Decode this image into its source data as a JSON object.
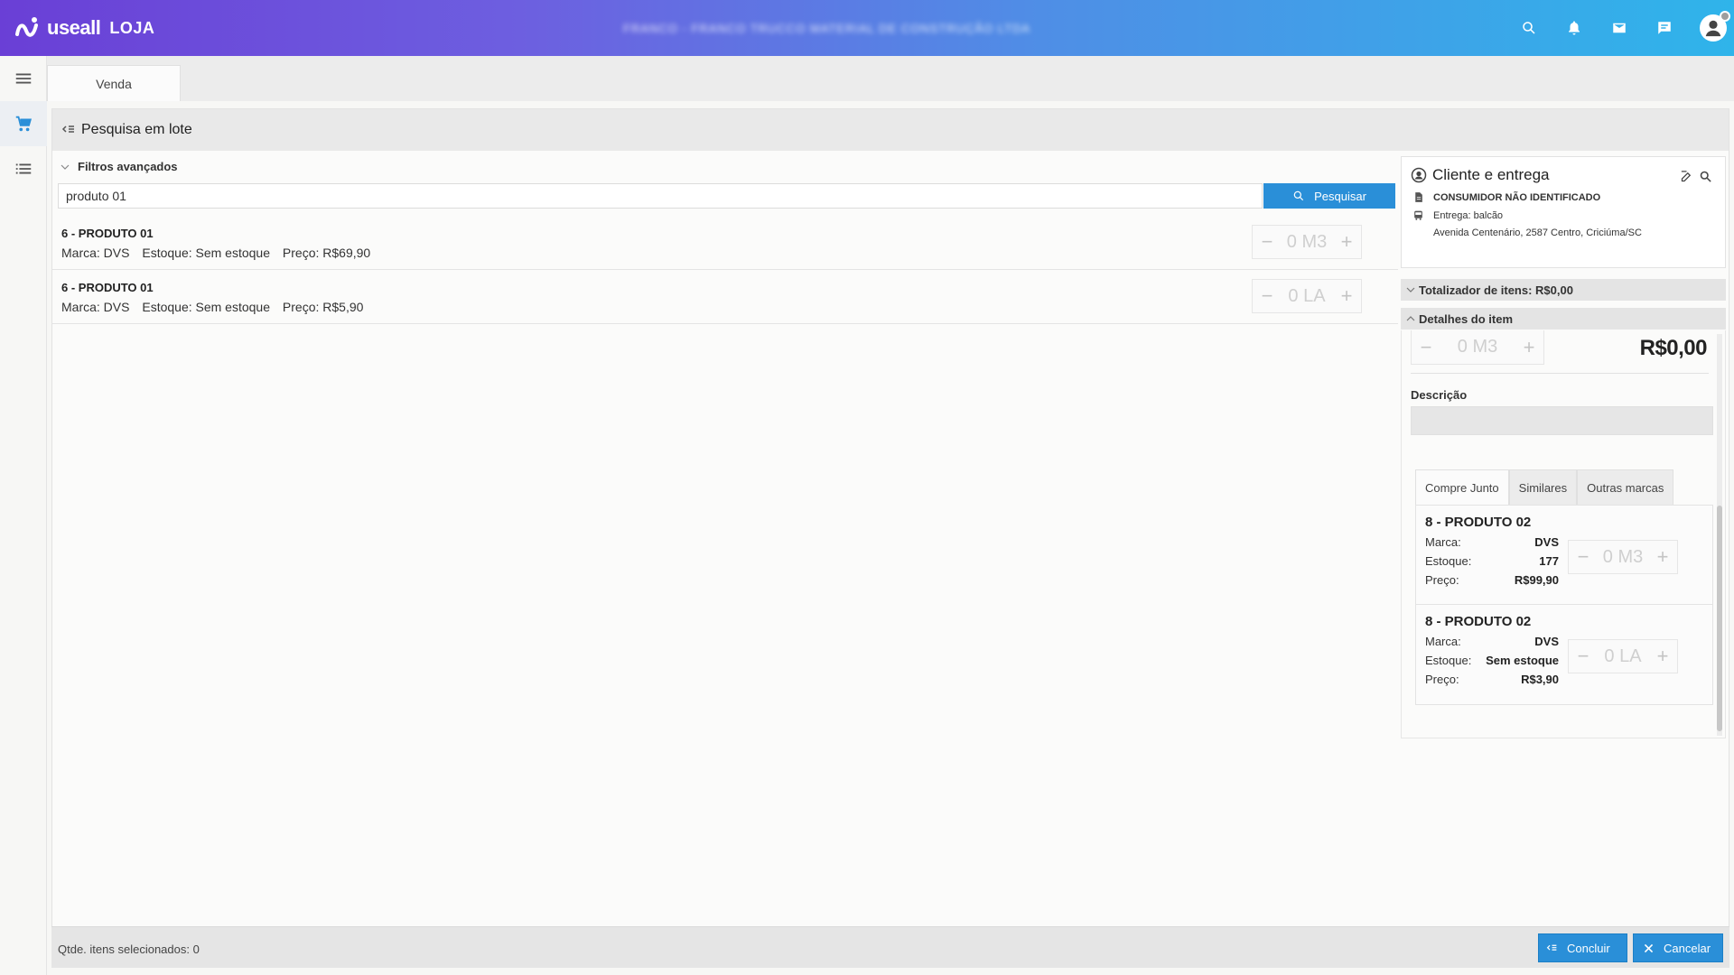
{
  "header": {
    "brand": "useall",
    "product": "LOJA",
    "title_blurred": "FRANCO - FRANCO TRUCCO MATERIAL DE CONSTRUÇÃO LTDA"
  },
  "tabs": [
    {
      "label": "Venda"
    }
  ],
  "panel": {
    "title": "Pesquisa em lote",
    "filters_label": "Filtros avançados",
    "search_value": "produto 01",
    "search_button": "Pesquisar"
  },
  "results": [
    {
      "name": "6 - PRODUTO 01",
      "brand": "Marca: DVS",
      "stock": "Estoque: Sem estoque",
      "price": "Preço: R$69,90",
      "qty": "0 M3"
    },
    {
      "name": "6 - PRODUTO 01",
      "brand": "Marca: DVS",
      "stock": "Estoque: Sem estoque",
      "price": "Preço: R$5,90",
      "qty": "0 LA"
    }
  ],
  "client": {
    "title": "Cliente e entrega",
    "customer": "CONSUMIDOR NÃO IDENTIFICADO",
    "delivery": "Entrega: balcão",
    "address": "Avenida Centenário, 2587 Centro, Criciúma/SC"
  },
  "totalizer": "Totalizador de itens: R$0,00",
  "details": {
    "title": "Detalhes do item",
    "qty": "0 M3",
    "price": "R$0,00",
    "description_label": "Descrição",
    "tabs": [
      "Compre Junto",
      "Similares",
      "Outras marcas"
    ],
    "items": [
      {
        "name": "8 - PRODUTO 02",
        "brand_label": "Marca:",
        "brand": "DVS",
        "stock_label": "Estoque:",
        "stock": "177",
        "price_label": "Preço:",
        "price": "R$99,90",
        "qty": "0 M3"
      },
      {
        "name": "8 - PRODUTO 02",
        "brand_label": "Marca:",
        "brand": "DVS",
        "stock_label": "Estoque:",
        "stock": "Sem estoque",
        "price_label": "Preço:",
        "price": "R$3,90",
        "qty": "0 LA"
      }
    ]
  },
  "footer": {
    "selected": "Qtde. itens selecionados: 0",
    "confirm": "Concluir",
    "cancel": "Cancelar"
  },
  "stepper": {
    "minus": "−",
    "plus": "+"
  },
  "colors": {
    "primary": "#2a8fd8",
    "header_start": "#6a3fd6",
    "header_end": "#2fb4ea"
  }
}
